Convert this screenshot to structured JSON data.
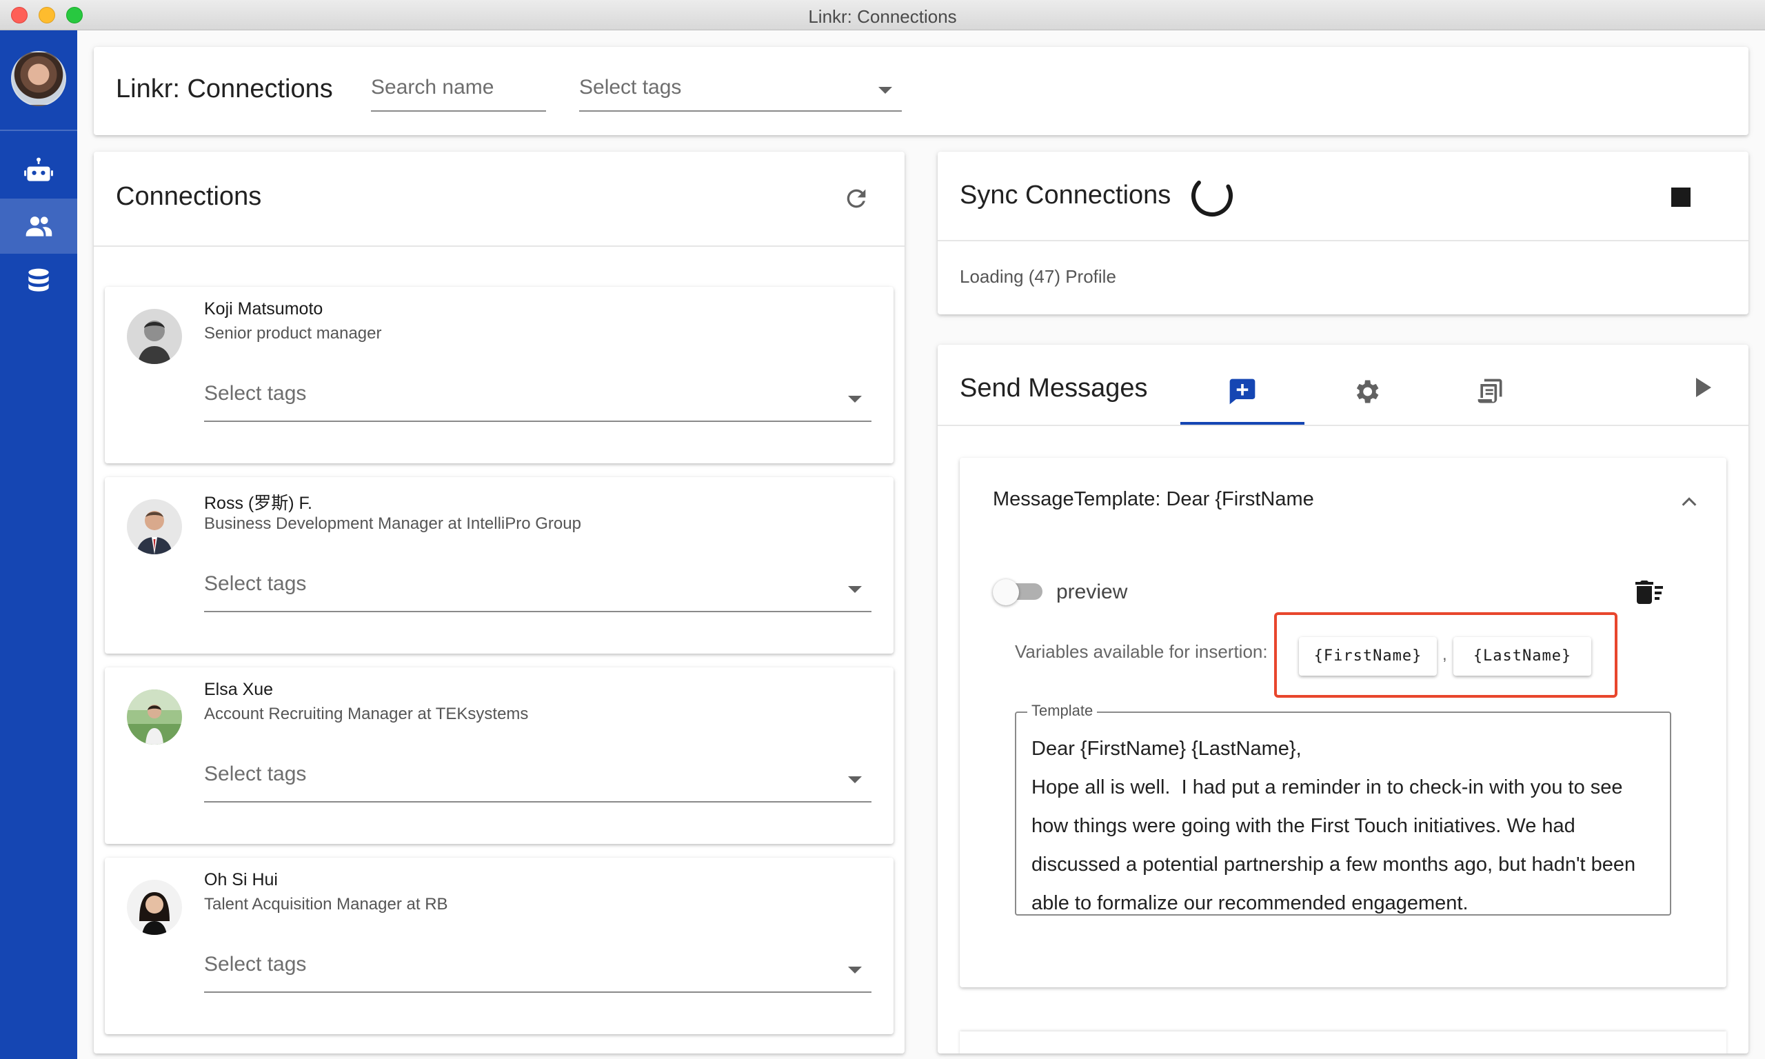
{
  "window": {
    "title": "Linkr: Connections"
  },
  "sidebar": {
    "items": [
      {
        "name": "bot",
        "icon": "robot-icon",
        "active": false
      },
      {
        "name": "connections",
        "icon": "people-icon",
        "active": true
      },
      {
        "name": "database",
        "icon": "database-icon",
        "active": false
      }
    ]
  },
  "header": {
    "title": "Linkr: Connections",
    "search_placeholder": "Search name",
    "tags_placeholder": "Select tags"
  },
  "connections": {
    "title": "Connections",
    "tags_placeholder": "Select tags",
    "items": [
      {
        "name": "Koji Matsumoto",
        "headline": "Senior product manager"
      },
      {
        "name": "Ross (罗斯) F.",
        "headline": "Business Development Manager at IntelliPro Group"
      },
      {
        "name": "Elsa Xue",
        "headline": "Account Recruiting Manager at TEKsystems"
      },
      {
        "name": "Oh Si Hui",
        "headline": "Talent Acquisition Manager at RB"
      }
    ]
  },
  "sync": {
    "title": "Sync Connections",
    "status": "Loading (47) Profile"
  },
  "send": {
    "title": "Send Messages",
    "tabs": [
      "new-message-icon",
      "settings-icon",
      "log-icon"
    ],
    "active_tab": 0,
    "template_header": "MessageTemplate: Dear {FirstName",
    "preview_label": "preview",
    "preview_on": false,
    "vars_label": "Variables available for insertion:",
    "variables": [
      "{FirstName}",
      "{LastName}"
    ],
    "variable_separator": ",",
    "template_legend": "Template",
    "template_text": "Dear {FirstName} {LastName},\nHope all is well.  I had put a reminder in to check-in with you to see how things were going with the First Touch initiatives. We had discussed a potential partnership a few months ago, but hadn't been able to formalize our recommended engagement."
  },
  "colors": {
    "sidebar": "#1546b3",
    "accent": "#1546b3",
    "highlight": "#e8462d"
  }
}
